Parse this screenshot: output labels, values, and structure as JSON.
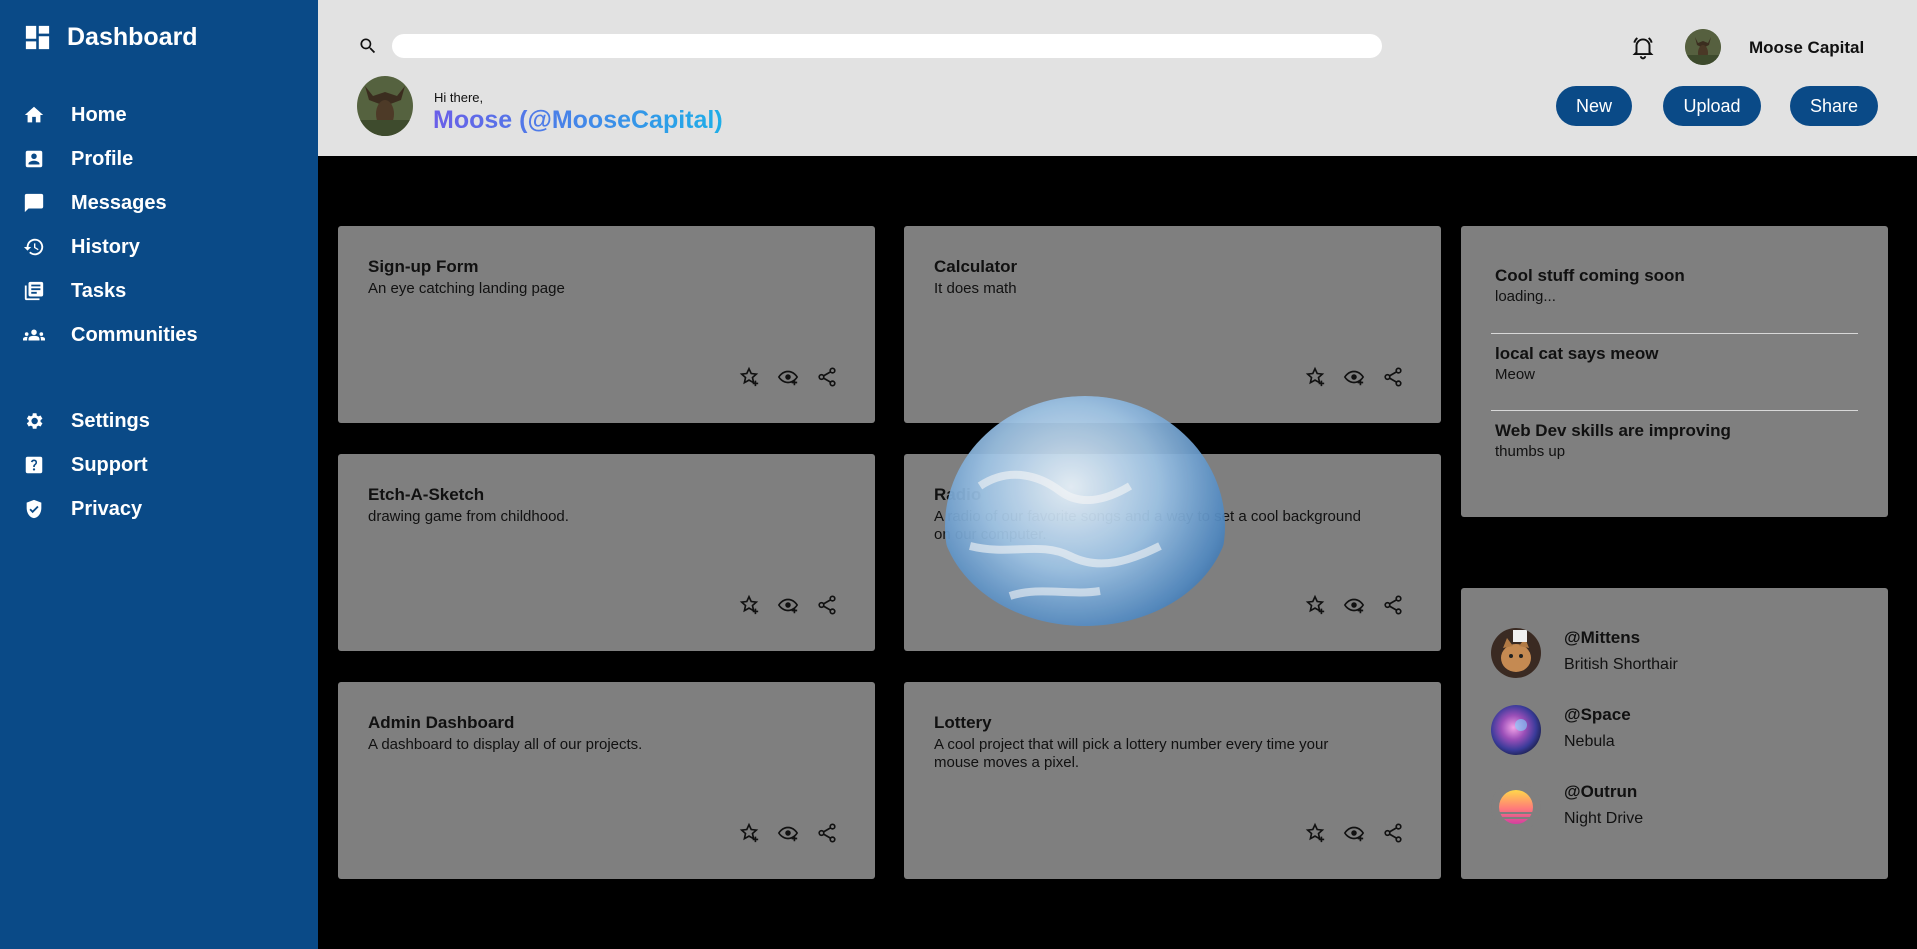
{
  "sidebar": {
    "brand": "Dashboard",
    "nav_primary": [
      {
        "label": "Home",
        "icon": "home-icon"
      },
      {
        "label": "Profile",
        "icon": "profile-icon"
      },
      {
        "label": "Messages",
        "icon": "messages-icon"
      },
      {
        "label": "History",
        "icon": "history-icon"
      },
      {
        "label": "Tasks",
        "icon": "tasks-icon"
      },
      {
        "label": "Communities",
        "icon": "communities-icon"
      }
    ],
    "nav_secondary": [
      {
        "label": "Settings",
        "icon": "gear-icon"
      },
      {
        "label": "Support",
        "icon": "help-icon"
      },
      {
        "label": "Privacy",
        "icon": "shield-icon"
      }
    ]
  },
  "header": {
    "search": {
      "value": "",
      "placeholder": ""
    },
    "user_name": "Moose Capital",
    "greeting": "Hi there,",
    "display_name": "Moose (@MooseCapital)",
    "buttons": {
      "new": "New",
      "upload": "Upload",
      "share": "Share"
    }
  },
  "projects": [
    {
      "title": "Sign-up Form",
      "desc": "An eye catching landing page"
    },
    {
      "title": "Calculator",
      "desc": "It does math"
    },
    {
      "title": "Etch-A-Sketch",
      "desc": "drawing game from childhood."
    },
    {
      "title": "Radio",
      "desc": "A radio of our favorite songs and a way to set a cool background on our computer."
    },
    {
      "title": "Admin Dashboard",
      "desc": "A dashboard to display all of our projects."
    },
    {
      "title": "Lottery",
      "desc": "A cool project that will pick a lottery number every time your mouse moves a pixel."
    }
  ],
  "announcements": [
    {
      "title": "Cool stuff coming soon",
      "sub": "loading..."
    },
    {
      "title": "local cat says meow",
      "sub": "Meow"
    },
    {
      "title": "Web Dev skills are improving",
      "sub": "thumbs up"
    }
  ],
  "trending": [
    {
      "handle": "@Mittens",
      "sub": "British Shorthair"
    },
    {
      "handle": "@Space",
      "sub": "Nebula"
    },
    {
      "handle": "@Outrun",
      "sub": "Night Drive"
    }
  ],
  "colors": {
    "sidebar": "#0a4a87",
    "header": "#e2e2e2",
    "card": "#7f7f7f",
    "background": "#000000",
    "accent_gradient": [
      "#6a5ee8",
      "#1eaee8"
    ]
  }
}
